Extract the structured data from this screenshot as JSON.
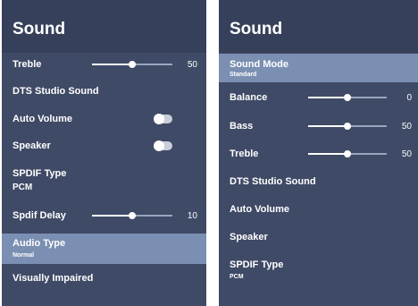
{
  "left_panel": {
    "title": "Sound",
    "items": [
      {
        "label": "Treble",
        "value": "50",
        "slider_fraction": 0.5
      },
      {
        "label": "DTS Studio Sound"
      },
      {
        "label": "Auto Volume",
        "toggle": "off"
      },
      {
        "label": "Speaker",
        "toggle": "off"
      },
      {
        "label": "SPDIF Type",
        "sub": "PCM"
      },
      {
        "label": "Spdif Delay",
        "value": "10",
        "slider_fraction": 0.5
      },
      {
        "label": "Audio Type",
        "sub": "Normal",
        "selected": true
      },
      {
        "label": "Visually Impaired"
      }
    ]
  },
  "right_panel": {
    "title": "Sound",
    "items": [
      {
        "label": "Sound Mode",
        "sub": "Standard",
        "selected": true
      },
      {
        "label": "Balance",
        "value": "0",
        "slider_fraction": 0.5
      },
      {
        "label": "Bass",
        "value": "50",
        "slider_fraction": 0.5
      },
      {
        "label": "Treble",
        "value": "50",
        "slider_fraction": 0.5
      },
      {
        "label": "DTS Studio Sound"
      },
      {
        "label": "Auto Volume"
      },
      {
        "label": "Speaker"
      },
      {
        "label": "SPDIF Type",
        "sub": "PCM"
      }
    ]
  },
  "colors": {
    "panel_bg": "#3f4a66",
    "header_bg": "#36405a",
    "selected_bg": "#7a8fb2",
    "text": "#ffffff"
  }
}
